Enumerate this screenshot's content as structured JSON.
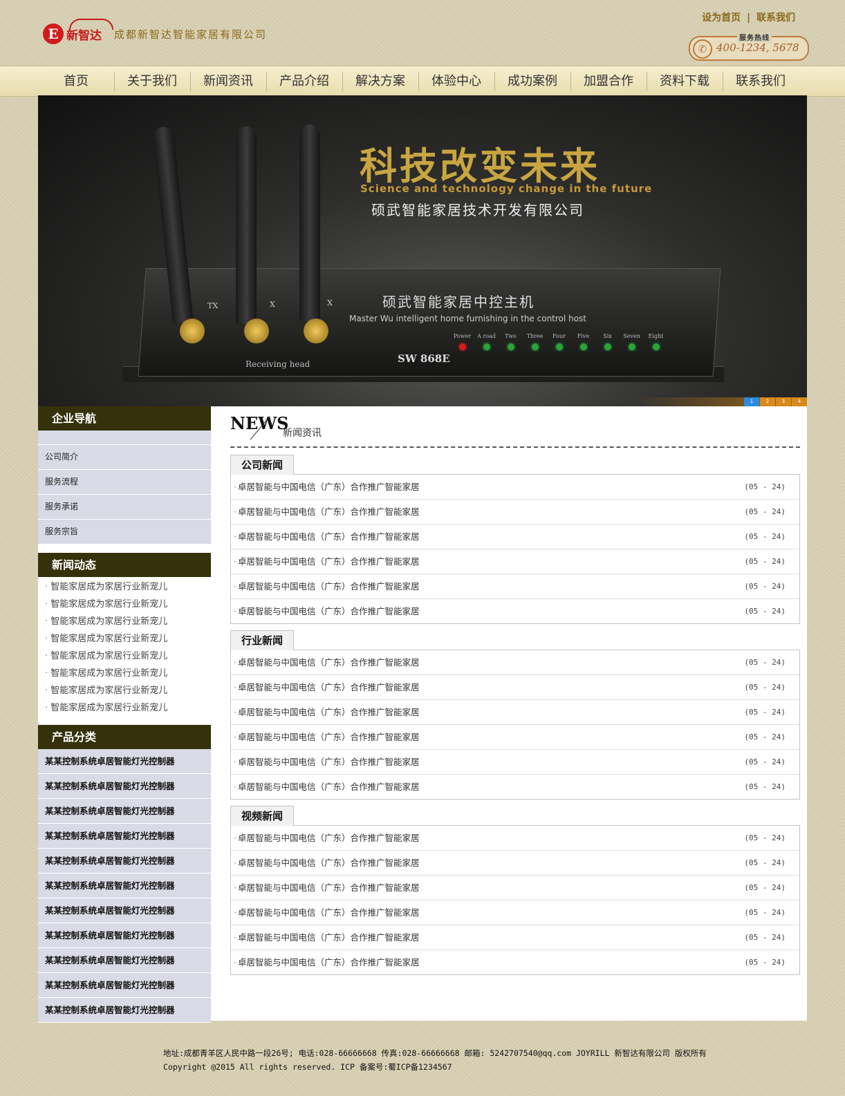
{
  "header": {
    "brand": "新智达",
    "logo_letter": "E",
    "company": "成都新智达智能家居有限公司",
    "top_links": [
      "设为首页",
      "联系我们"
    ],
    "top_sep": "|",
    "hotline_label": "服务热线",
    "hotline_number": "400-1234, 5678"
  },
  "nav": [
    "首页",
    "关于我们",
    "新闻资讯",
    "产品介绍",
    "解决方案",
    "体验中心",
    "成功案例",
    "加盟合作",
    "资料下载",
    "联系我们"
  ],
  "banner": {
    "title": "科技改变未来",
    "subtitle": "Science and technology change in the future",
    "company": "硕武智能家居技术开发有限公司",
    "device_name": "硕武智能家居中控主机",
    "device_en": "Master Wu intelligent home furnishing in the control host",
    "model": "SW 868E",
    "receiving": "Receiving head",
    "antenna_labels": [
      "TX",
      "X",
      "X"
    ],
    "leds": [
      "Power",
      "A road",
      "Two",
      "Three",
      "Four",
      "Five",
      "Six",
      "Seven",
      "Eight"
    ],
    "slides": [
      "1",
      "2",
      "3",
      "4"
    ]
  },
  "sidebar": {
    "nav_title": "企业导航",
    "nav_items": [
      "公司简介",
      "服务流程",
      "服务承诺",
      "服务宗旨"
    ],
    "news_title": "新闻动态",
    "news_items": [
      "智能家居成为家居行业新宠儿",
      "智能家居成为家居行业新宠儿",
      "智能家居成为家居行业新宠儿",
      "智能家居成为家居行业新宠儿",
      "智能家居成为家居行业新宠儿",
      "智能家居成为家居行业新宠儿",
      "智能家居成为家居行业新宠儿",
      "智能家居成为家居行业新宠儿"
    ],
    "product_title": "产品分类",
    "product_items": [
      "某某控制系统卓居智能灯光控制器",
      "某某控制系统卓居智能灯光控制器",
      "某某控制系统卓居智能灯光控制器",
      "某某控制系统卓居智能灯光控制器",
      "某某控制系统卓居智能灯光控制器",
      "某某控制系统卓居智能灯光控制器",
      "某某控制系统卓居智能灯光控制器",
      "某某控制系统卓居智能灯光控制器",
      "某某控制系统卓居智能灯光控制器",
      "某某控制系统卓居智能灯光控制器",
      "某某控制系统卓居智能灯光控制器"
    ]
  },
  "main": {
    "news_title": "NEWS",
    "news_subtitle": "新闻资讯",
    "sections": [
      {
        "title": "公司新闻",
        "rows": [
          {
            "text": "卓居智能与中国电信（广东）合作推广智能家居",
            "date": "(05 - 24)"
          },
          {
            "text": "卓居智能与中国电信（广东）合作推广智能家居",
            "date": "(05 - 24)"
          },
          {
            "text": "卓居智能与中国电信（广东）合作推广智能家居",
            "date": "(05 - 24)"
          },
          {
            "text": "卓居智能与中国电信（广东）合作推广智能家居",
            "date": "(05 - 24)"
          },
          {
            "text": "卓居智能与中国电信（广东）合作推广智能家居",
            "date": "(05 - 24)"
          },
          {
            "text": "卓居智能与中国电信（广东）合作推广智能家居",
            "date": "(05 - 24)"
          }
        ]
      },
      {
        "title": "行业新闻",
        "rows": [
          {
            "text": "卓居智能与中国电信（广东）合作推广智能家居",
            "date": "(05 - 24)"
          },
          {
            "text": "卓居智能与中国电信（广东）合作推广智能家居",
            "date": "(05 - 24)"
          },
          {
            "text": "卓居智能与中国电信（广东）合作推广智能家居",
            "date": "(05 - 24)"
          },
          {
            "text": "卓居智能与中国电信（广东）合作推广智能家居",
            "date": "(05 - 24)"
          },
          {
            "text": "卓居智能与中国电信（广东）合作推广智能家居",
            "date": "(05 - 24)"
          },
          {
            "text": "卓居智能与中国电信（广东）合作推广智能家居",
            "date": "(05 - 24)"
          }
        ]
      },
      {
        "title": "视频新闻",
        "rows": [
          {
            "text": "卓居智能与中国电信（广东）合作推广智能家居",
            "date": "(05 - 24)"
          },
          {
            "text": "卓居智能与中国电信（广东）合作推广智能家居",
            "date": "(05 - 24)"
          },
          {
            "text": "卓居智能与中国电信（广东）合作推广智能家居",
            "date": "(05 - 24)"
          },
          {
            "text": "卓居智能与中国电信（广东）合作推广智能家居",
            "date": "(05 - 24)"
          },
          {
            "text": "卓居智能与中国电信（广东）合作推广智能家居",
            "date": "(05 - 24)"
          },
          {
            "text": "卓居智能与中国电信（广东）合作推广智能家居",
            "date": "(05 - 24)"
          }
        ]
      }
    ]
  },
  "footer": {
    "line1": "地址:成都青羊区人民中路一段26号; 电话:028-66666668 传真:028-66666668 邮箱: 5242707540@qq.com JOYRILL 新智达有限公司 版权所有",
    "line2": "Copyright @2015 All rights reserved. ICP 备案号:蜀ICP备1234567"
  }
}
